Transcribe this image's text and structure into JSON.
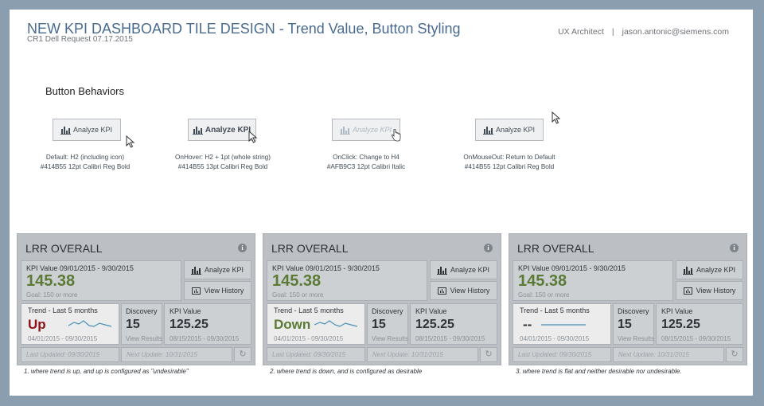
{
  "header": {
    "title": "NEW KPI DASHBOARD TILE DESIGN - Trend Value, Button Styling",
    "subtitle": "CR1 Dell Request 07.17.2015",
    "role": "UX Architect",
    "separator": "|",
    "email": "jason.antonic@siemens.com"
  },
  "section_title": "Button Behaviors",
  "button_demos": [
    {
      "label": "Analyze KPI",
      "caption1": "Default: H2 (including icon)",
      "caption2": "#414B55  12pt Calibri Reg Bold"
    },
    {
      "label": "Analyze KPI",
      "caption1": "OnHover:  H2 + 1pt (whole string)",
      "caption2": "#414B55  13pt Calibri Reg Bold"
    },
    {
      "label": "Analyze KPI",
      "caption1": "OnClick:  Change to H4",
      "caption2": "#AFB9C3  12pt Calibri Italic"
    },
    {
      "label": "Analyze KPI",
      "caption1": "OnMouseOut:  Return to Default",
      "caption2": "#414B55  12pt Calibri Reg Bold"
    }
  ],
  "tiles": [
    {
      "title": "LRR OVERALL",
      "kpi_range": "KPI Value 09/01/2015 - 9/30/2015",
      "kpi_value": "145.38",
      "goal": "Goal: 150 or more",
      "analyze_label": "Analyze KPI",
      "history_label": "View History",
      "trend_label": "Trend - Last 5 months",
      "trend_word": "Up",
      "trend_dates": "04/01/2015 - 09/30/2015",
      "discovery_label": "Discovery",
      "discovery_value": "15",
      "discovery_link": "View Results",
      "kv_label": "KPI Value",
      "kv_value": "125.25",
      "kv_dates": "08/15/2015 - 09/30/2015",
      "last_updated": "Last Updated: 09/30/2015",
      "next_update": "Next Update: 10/31/2015",
      "note": "1. where trend is up, and up is configured as \"undesirable\""
    },
    {
      "title": "LRR OVERALL",
      "kpi_range": "KPI Value 09/01/2015 - 9/30/2015",
      "kpi_value": "145.38",
      "goal": "Goal: 150 or more",
      "analyze_label": "Analyze KPI",
      "history_label": "View History",
      "trend_label": "Trend - Last 5 months",
      "trend_word": "Down",
      "trend_dates": "04/01/2015 - 09/30/2015",
      "discovery_label": "Discovery",
      "discovery_value": "15",
      "discovery_link": "View Results",
      "kv_label": "KPI Value",
      "kv_value": "125.25",
      "kv_dates": "08/15/2015 - 09/30/2015",
      "last_updated": "Last Updated: 09/30/2015",
      "next_update": "Next Update: 10/31/2015",
      "note": "2. where trend is down, and is configured as desirable"
    },
    {
      "title": "LRR OVERALL",
      "kpi_range": "KPI Value 09/01/2015 - 9/30/2015",
      "kpi_value": "145.38",
      "goal": "Goal: 150 or more",
      "analyze_label": "Analyze KPI",
      "history_label": "View History",
      "trend_label": "Trend - Last 5 months",
      "trend_word": "--",
      "trend_dates": "04/01/2015 - 09/30/2015",
      "discovery_label": "Discovery",
      "discovery_value": "15",
      "discovery_link": "View Results",
      "kv_label": "KPI Value",
      "kv_value": "125.25",
      "kv_dates": "08/15/2015 - 09/30/2015",
      "last_updated": "Last Updated: 09/30/2015",
      "next_update": "Next Update: 10/31/2015",
      "note": "3. where trend is flat and neither desirable nor undesirable."
    }
  ],
  "colors": {
    "default_text": "#414B55",
    "click_text": "#AFB9C3",
    "trend_up": "#8b1418",
    "trend_down": "#5a7a36",
    "kpi_value": "#5a7a36",
    "sparkline": "#4a90b8"
  },
  "icons": {
    "button_icon": "bar-chart-icon",
    "history_icon": "history-chart-icon",
    "info_icon": "info-icon",
    "refresh_icon": "refresh-icon",
    "cursor": "mouse-pointer-icon"
  }
}
